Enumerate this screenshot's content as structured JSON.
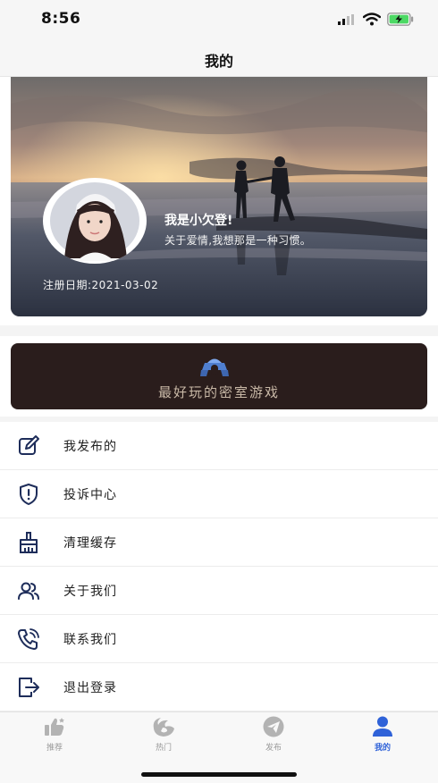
{
  "status_bar": {
    "time": "8:56",
    "icons": [
      "signal-icon",
      "wifi-icon",
      "battery-charging-icon"
    ],
    "battery_color": "#4cd964"
  },
  "nav": {
    "title": "我的"
  },
  "profile": {
    "username": "我是小欠登!",
    "bio": "关于爱情,我想那是一种习惯。",
    "register_label": "注册日期:",
    "register_date": "2021-03-02",
    "background_image": "sunset-beach-couple",
    "avatar_image": "girl-portrait-avatar"
  },
  "banner": {
    "text": "最好玩的密室游戏",
    "logo": "escape-room-logo-icon",
    "background_color": "#2a1d1c"
  },
  "menu": {
    "items": [
      {
        "label": "我发布的",
        "icon": "edit-icon"
      },
      {
        "label": "投诉中心",
        "icon": "shield-alert-icon"
      },
      {
        "label": "清理缓存",
        "icon": "broom-icon"
      },
      {
        "label": "关于我们",
        "icon": "users-icon"
      },
      {
        "label": "联系我们",
        "icon": "phone-call-icon"
      },
      {
        "label": "退出登录",
        "icon": "logout-icon"
      }
    ]
  },
  "tabs": {
    "items": [
      {
        "label": "推荐",
        "icon": "thumbs-up-icon",
        "active": false
      },
      {
        "label": "热门",
        "icon": "hot-swirl-icon",
        "active": false
      },
      {
        "label": "发布",
        "icon": "send-icon",
        "active": false
      },
      {
        "label": "我的",
        "icon": "user-icon",
        "active": true
      }
    ],
    "active_color": "#2f62d8",
    "inactive_color": "#b3b3b3"
  }
}
